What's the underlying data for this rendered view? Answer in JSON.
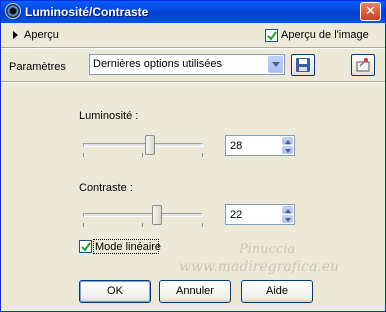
{
  "window": {
    "title": "Luminosité/Contraste",
    "close_glyph": "✕"
  },
  "preview": {
    "toggle_label": "Aperçu",
    "image_preview_label": "Aperçu de l'image",
    "image_preview_checked": true
  },
  "params": {
    "label": "Paramètres",
    "selected": "Dernières options utilisées",
    "save_icon": "floppy-disk-icon",
    "reset_icon": "reset-icon"
  },
  "brightness": {
    "label": "Luminosité :",
    "value": "28"
  },
  "contrast": {
    "label": "Contraste :",
    "value": "22"
  },
  "linear": {
    "label": "Mode linéaire",
    "checked": true
  },
  "buttons": {
    "ok": "OK",
    "cancel": "Annuler",
    "help": "Aide"
  },
  "watermark": {
    "line1": "Pinuccia",
    "line2": "www.madiregrafica.eu"
  },
  "colors": {
    "titlebar": "#0a5cff",
    "background": "#ece9d8",
    "close": "#c8421f"
  }
}
